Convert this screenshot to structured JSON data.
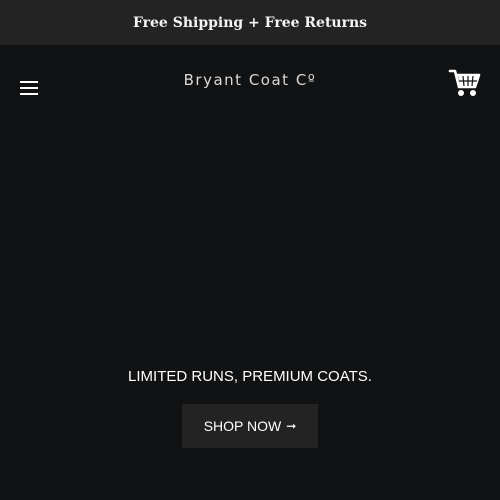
{
  "announcement": {
    "text": "Free Shipping + Free Returns"
  },
  "header": {
    "logo_text": "Bryant Coat Cº",
    "menu_icon": "hamburger-menu-icon",
    "cart_icon": "shopping-cart-icon"
  },
  "hero": {
    "headline": "LIMITED RUNS, PREMIUM COATS.",
    "cta_label": "SHOP NOW",
    "cta_arrow": "➞"
  },
  "colors": {
    "page_background": "#111214",
    "bar_background": "#222322",
    "text": "#ffffff"
  }
}
